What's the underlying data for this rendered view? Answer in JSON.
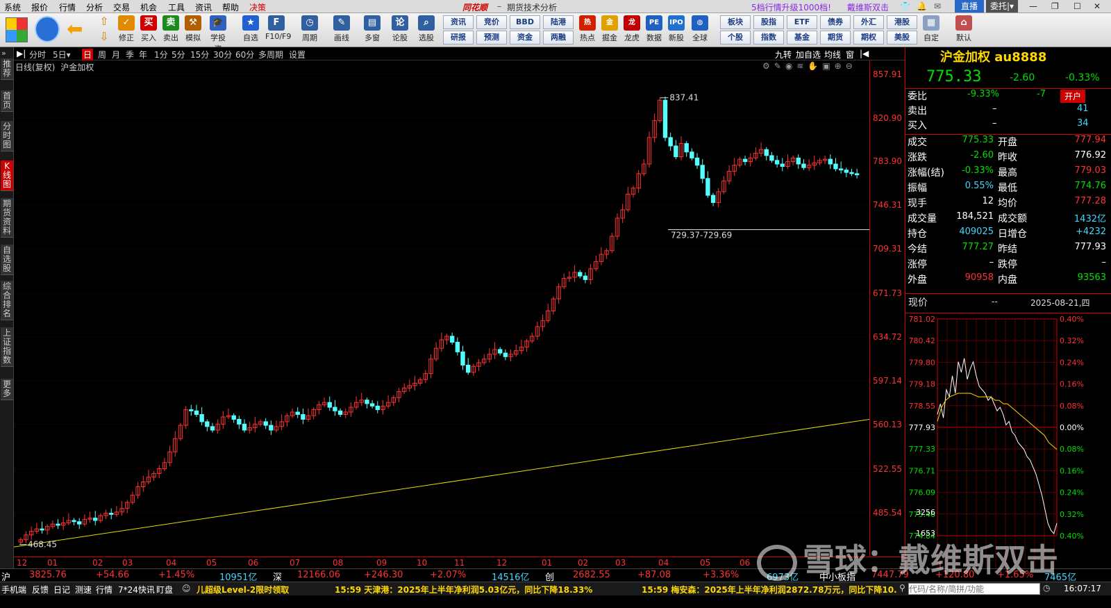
{
  "menu": {
    "items": [
      "系统",
      "报价",
      "行情",
      "分析",
      "交易",
      "机会",
      "工具",
      "资讯",
      "帮助",
      "决策"
    ],
    "logo": "同花顺",
    "app_title": "期货技术分析",
    "promo": "5档行情升级1000档!",
    "user": "戴维斯双击",
    "live_button": "直播",
    "delegate_button": "委托"
  },
  "toolbar": {
    "big_buttons": [
      {
        "label": "修正",
        "icon": "revise-icon",
        "color": "#e08a00"
      },
      {
        "label": "买入",
        "icon": "buy-icon",
        "color": "#d00000"
      },
      {
        "label": "卖出",
        "icon": "sell-icon",
        "color": "#1e8a1e"
      },
      {
        "label": "模拟",
        "icon": "hammer-icon",
        "color": "#b06000"
      },
      {
        "label": "学投资",
        "icon": "graduation-icon",
        "color": "#3060c0"
      },
      {
        "label": "自选",
        "icon": "star-icon",
        "color": "#2060d0"
      },
      {
        "label": "F10/F9",
        "icon": "f10-icon",
        "color": "#3060a0"
      },
      {
        "label": "周期",
        "icon": "clock-icon",
        "color": "#3060a0"
      },
      {
        "label": "画线",
        "icon": "pen-icon",
        "color": "#3060a0"
      },
      {
        "label": "多窗",
        "icon": "window-icon",
        "color": "#3060a0"
      },
      {
        "label": "论股",
        "icon": "chat-icon",
        "color": "#3060a0"
      },
      {
        "label": "选股",
        "icon": "search-icon",
        "color": "#3060a0"
      }
    ],
    "small_buttons": [
      {
        "label": "资讯"
      },
      {
        "label": "竞价"
      },
      {
        "label": "BBD"
      },
      {
        "label": "陆港"
      },
      {
        "label": "研报"
      },
      {
        "label": "预测"
      },
      {
        "label": "资金"
      },
      {
        "label": "两融"
      }
    ],
    "mid_buttons": [
      {
        "label": "热点",
        "icon": "hot-icon",
        "color": "#d02000"
      },
      {
        "label": "掘金",
        "icon": "gold-icon",
        "color": "#e0a000"
      },
      {
        "label": "龙虎",
        "icon": "dragon-icon",
        "color": "#c00000"
      },
      {
        "label": "数据",
        "icon": "pe-icon",
        "color": "#2060c0"
      },
      {
        "label": "新股",
        "icon": "ipo-icon",
        "color": "#2070d0"
      },
      {
        "label": "全球",
        "icon": "globe-icon",
        "color": "#2060c0"
      }
    ],
    "right_buttons": [
      {
        "label": "板块"
      },
      {
        "label": "股指"
      },
      {
        "label": "ETF"
      },
      {
        "label": "债券"
      },
      {
        "label": "外汇"
      },
      {
        "label": "港股"
      },
      {
        "label": "个股"
      },
      {
        "label": "指数"
      },
      {
        "label": "基金"
      },
      {
        "label": "期货"
      },
      {
        "label": "期权"
      },
      {
        "label": "美股"
      }
    ],
    "custom_label": "自定",
    "default_label": "默认"
  },
  "leftnav": [
    "推荐",
    "首页",
    "分时图",
    "K线图",
    "期货资料",
    "自选股",
    "综合排名",
    "上证指数",
    "更多"
  ],
  "periods": [
    "分时",
    "5日",
    "日",
    "周",
    "月",
    "季",
    "年",
    "1分",
    "5分",
    "15分",
    "30分",
    "60分",
    "多周期",
    "设置"
  ],
  "period_right": [
    "九转",
    "加自选",
    "均线",
    "窗"
  ],
  "chart_header": {
    "label": "日线(复权)",
    "name": "沪金加权"
  },
  "price_axis": [
    "857.91",
    "820.90",
    "783.90",
    "746.31",
    "709.31",
    "671.73",
    "634.72",
    "597.14",
    "560.13",
    "522.55",
    "485.54"
  ],
  "date_axis": [
    "12",
    "01",
    "02",
    "03",
    "04",
    "05",
    "06",
    "07",
    "08",
    "09",
    "10",
    "11",
    "12",
    "01",
    "02",
    "03",
    "04",
    "05",
    "06"
  ],
  "chart_data": {
    "type": "candlestick",
    "name": "沪金加权",
    "ylim": [
      458,
      870
    ],
    "high_label": "837.41",
    "low_label": "468.45",
    "range_label": "729.37-729.69",
    "trendline": {
      "from": 466,
      "to": 572,
      "color": "#e0e000"
    },
    "closes": [
      472,
      476,
      479,
      481,
      480,
      483,
      485,
      484,
      486,
      488,
      487,
      485,
      489,
      490,
      488,
      492,
      494,
      493,
      495,
      498,
      503,
      509,
      516,
      520,
      524,
      527,
      531,
      536,
      545,
      556,
      567,
      580,
      579,
      576,
      570,
      566,
      563,
      568,
      574,
      575,
      572,
      568,
      563,
      565,
      568,
      570,
      567,
      563,
      566,
      570,
      575,
      578,
      576,
      572,
      575,
      580,
      584,
      586,
      582,
      579,
      576,
      578,
      582,
      586,
      588,
      585,
      583,
      580,
      583,
      586,
      590,
      595,
      598,
      600,
      602,
      605,
      610,
      622,
      631,
      638,
      641,
      636,
      628,
      617,
      611,
      616,
      619,
      622,
      626,
      630,
      627,
      624,
      626,
      629,
      632,
      637,
      641,
      649,
      654,
      662,
      672,
      682,
      689,
      690,
      694,
      691,
      688,
      697,
      703,
      709,
      712,
      724,
      739,
      746,
      759,
      764,
      776,
      784,
      806,
      820,
      837,
      806,
      799,
      790,
      801,
      794,
      789,
      783,
      772,
      758,
      752,
      761,
      770,
      778,
      783,
      788,
      786,
      789,
      793,
      796,
      791,
      787,
      784,
      782,
      786,
      789,
      784,
      781,
      783,
      785,
      787,
      788,
      784,
      780,
      779,
      777,
      776,
      775
    ]
  },
  "quote": {
    "title": "沪金加权",
    "code": "au8888",
    "price": "775.33",
    "change": "-2.60",
    "change_pct": "-0.33%",
    "open_account": "开户",
    "rows": [
      {
        "l1": "委比",
        "v1": "-9.33%",
        "c1": "green",
        "v1b": "-7",
        "c1b": "green"
      },
      {
        "l1": "卖出",
        "v1": "–",
        "c1": "white",
        "v1b": "41",
        "c1b": "cyan"
      },
      {
        "l1": "买入",
        "v1": "–",
        "c1": "white",
        "v1b": "34",
        "c1b": "cyan"
      }
    ],
    "grid": [
      {
        "l1": "成交",
        "v1": "775.33",
        "c1": "green",
        "l2": "开盘",
        "v2": "777.94",
        "c2": "red"
      },
      {
        "l1": "涨跌",
        "v1": "-2.60",
        "c1": "green",
        "l2": "昨收",
        "v2": "776.92",
        "c2": "white"
      },
      {
        "l1": "涨幅(结)",
        "v1": "-0.33%",
        "c1": "green",
        "l2": "最高",
        "v2": "779.03",
        "c2": "red"
      },
      {
        "l1": "振幅",
        "v1": "0.55%",
        "c1": "cyan",
        "l2": "最低",
        "v2": "774.76",
        "c2": "green"
      },
      {
        "l1": "现手",
        "v1": "12",
        "c1": "white",
        "l2": "均价",
        "v2": "777.28",
        "c2": "red"
      },
      {
        "l1": "成交量",
        "v1": "184,521",
        "c1": "white",
        "l2": "成交额",
        "v2": "1432亿",
        "c2": "cyan"
      },
      {
        "l1": "持仓",
        "v1": "409025",
        "c1": "cyan",
        "l2": "日增仓",
        "v2": "+4232",
        "c2": "cyan"
      },
      {
        "l1": "今结",
        "v1": "777.27",
        "c1": "green",
        "l2": "昨结",
        "v2": "777.93",
        "c2": "white"
      },
      {
        "l1": "涨停",
        "v1": "–",
        "c1": "white",
        "l2": "跌停",
        "v2": "–",
        "c2": "white"
      },
      {
        "l1": "外盘",
        "v1": "90958",
        "c1": "red",
        "l2": "内盘",
        "v2": "93563",
        "c2": "green"
      }
    ],
    "now_label": "现价",
    "now_value": "--",
    "date": "2025-08-21,四"
  },
  "minichart": {
    "left": [
      "781.02",
      "780.42",
      "779.80",
      "779.18",
      "778.55",
      "777.93",
      "777.33",
      "776.71",
      "776.09",
      "775.46",
      "774.84"
    ],
    "right": [
      "0.40%",
      "0.32%",
      "0.24%",
      "0.16%",
      "0.08%",
      "0.00%",
      "0.08%",
      "0.16%",
      "0.24%",
      "0.32%",
      "0.40%"
    ],
    "vol": [
      "3256",
      "1653"
    ]
  },
  "status": {
    "sh_label": "沪",
    "sh_val": "3825.76",
    "sh_chg": "+54.66",
    "sh_pct": "+1.45%",
    "sh_amt": "10951亿",
    "sz_label": "深",
    "sz_val": "12166.06",
    "sz_chg": "+246.30",
    "sz_pct": "+2.07%",
    "sz_amt": "14516亿",
    "cy_label": "创",
    "cy_val": "2682.55",
    "cy_chg": "+87.08",
    "cy_pct": "+3.36%",
    "cy_amt": "6973亿",
    "zx_label": "中小板指",
    "zx_val": "7447.79",
    "zx_chg": "+120.80",
    "zx_pct": "+1.65%",
    "zx_amt": "7465亿"
  },
  "bottom": {
    "tabs": [
      "手机端",
      "反馈",
      "日记",
      "测速",
      "行情",
      "7*24快讯",
      "盯盘"
    ],
    "promo": "儿超级Level-2限时领取",
    "news1": "15:59 天津港：2025年上半年净利润5.03亿元，同比下降18.33%",
    "news2": "15:59 梅安森：2025年上半年净利润2872.78万元，同比下降10.",
    "search_placeholder": "代码/名称/简拼/功能",
    "clock": "16:07:17"
  },
  "watermark": "雪球：戴维斯双击"
}
